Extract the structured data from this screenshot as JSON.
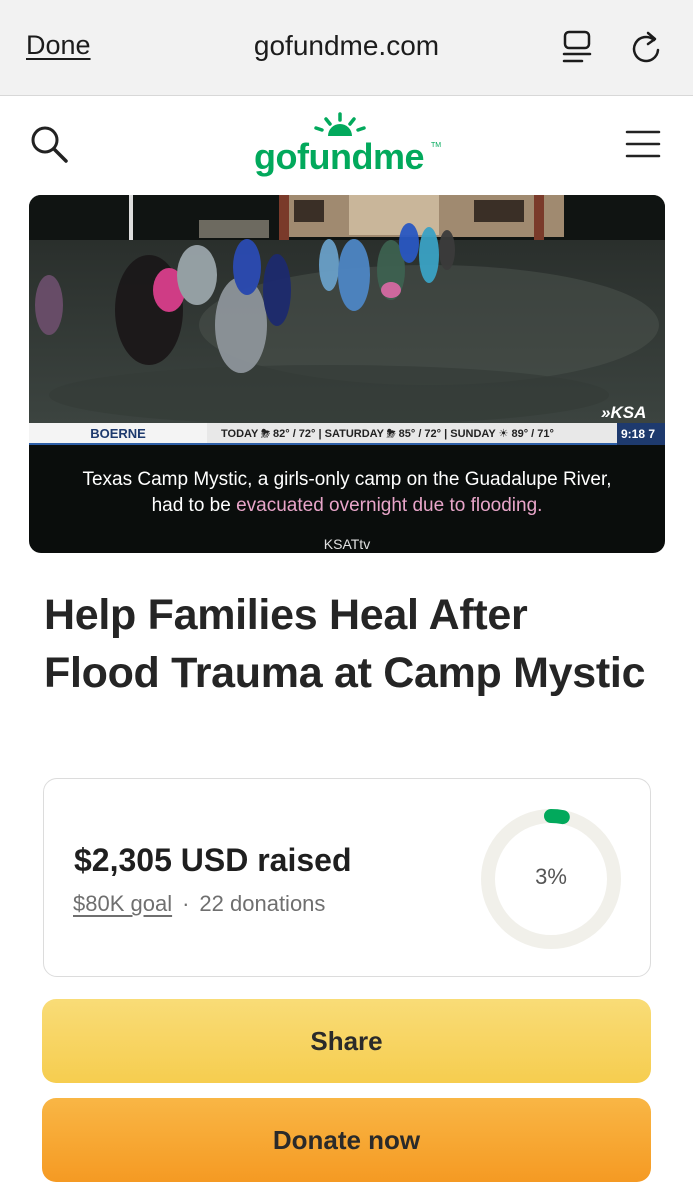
{
  "browser": {
    "done_label": "Done",
    "url": "gofundme.com"
  },
  "site": {
    "logo_text": "gofundme",
    "logo_tm": "TM"
  },
  "hero": {
    "location": "BOERNE",
    "weather": "TODAY ⛈ 82° / 72° | SATURDAY ⛈ 85° / 72° | SUNDAY ☀ 89° / 71°",
    "time": "9:18  7",
    "station": "»KSA",
    "caption_line1": "Texas Camp Mystic, a girls-only camp on the Guadalupe River,",
    "caption_line2_a": "had to be ",
    "caption_line2_b": "evacuated overnight due to flooding.",
    "credit": "KSATtv"
  },
  "campaign": {
    "title": "Help Families Heal After Flood Trauma at Camp Mystic",
    "raised": "$2,305 USD raised",
    "goal": "$80K goal",
    "separator": "·",
    "donations": "22 donations",
    "percent_label": "3%",
    "progress_fraction": 0.03
  },
  "actions": {
    "share_label": "Share",
    "donate_label": "Donate now"
  },
  "colors": {
    "brand_green": "#02a95c",
    "share_yellow": "#f6cd4f",
    "donate_orange": "#f59a23",
    "ring_track": "#f1f0ea"
  }
}
